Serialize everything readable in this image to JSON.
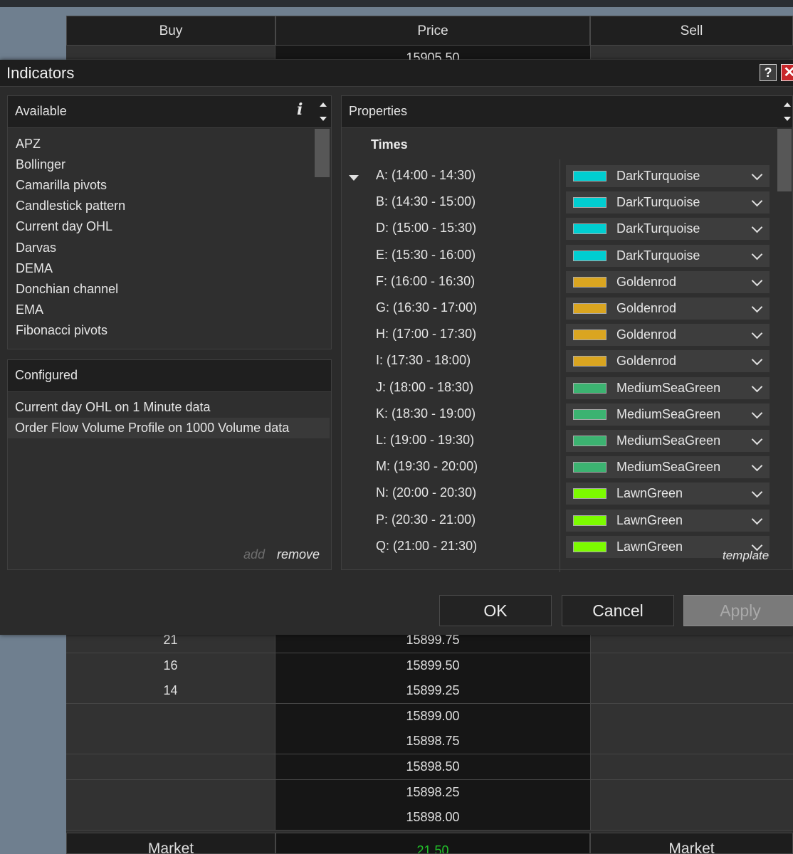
{
  "ladder": {
    "headers": {
      "buy": "Buy",
      "price": "Price",
      "sell": "Sell"
    },
    "top_row": {
      "buy": "",
      "price": "15905.50",
      "sell": ""
    },
    "rows": [
      {
        "buy": "21",
        "price": "15899.75",
        "sell": ""
      },
      {
        "buy": "16",
        "price": "15899.50",
        "sell": ""
      },
      {
        "buy": "14",
        "price": "15899.25",
        "sell": ""
      },
      {
        "buy": "",
        "price": "15899.00",
        "sell": ""
      },
      {
        "buy": "",
        "price": "15898.75",
        "sell": ""
      },
      {
        "buy": "",
        "price": "15898.50",
        "sell": ""
      },
      {
        "buy": "",
        "price": "15898.25",
        "sell": ""
      },
      {
        "buy": "",
        "price": "15898.00",
        "sell": ""
      }
    ],
    "footer": {
      "buy": "Market",
      "price": "21.50",
      "sell": "Market"
    }
  },
  "dialog": {
    "title": "Indicators",
    "help": "?",
    "close": "✕",
    "available": {
      "title": "Available",
      "items": [
        "APZ",
        "Bollinger",
        "Camarilla pivots",
        "Candlestick pattern",
        "Current day OHL",
        "Darvas",
        "DEMA",
        "Donchian channel",
        "EMA",
        "Fibonacci pivots"
      ]
    },
    "configured": {
      "title": "Configured",
      "items": [
        "Current day OHL on 1 Minute data",
        "Order Flow Volume Profile on 1000 Volume data"
      ],
      "selected_index": 1,
      "add_label": "add",
      "remove_label": "remove"
    },
    "properties": {
      "title": "Properties",
      "group": "Times",
      "rows": [
        {
          "label": "A: (14:00 - 14:30)",
          "color_name": "DarkTurquoise",
          "color": "#00ced1"
        },
        {
          "label": "B: (14:30 - 15:00)",
          "color_name": "DarkTurquoise",
          "color": "#00ced1"
        },
        {
          "label": "D: (15:00 - 15:30)",
          "color_name": "DarkTurquoise",
          "color": "#00ced1"
        },
        {
          "label": "E: (15:30 - 16:00)",
          "color_name": "DarkTurquoise",
          "color": "#00ced1"
        },
        {
          "label": "F: (16:00 - 16:30)",
          "color_name": "Goldenrod",
          "color": "#daa520"
        },
        {
          "label": "G: (16:30 - 17:00)",
          "color_name": "Goldenrod",
          "color": "#daa520"
        },
        {
          "label": "H: (17:00 - 17:30)",
          "color_name": "Goldenrod",
          "color": "#daa520"
        },
        {
          "label": "I: (17:30 - 18:00)",
          "color_name": "Goldenrod",
          "color": "#daa520"
        },
        {
          "label": "J: (18:00 - 18:30)",
          "color_name": "MediumSeaGreen",
          "color": "#3cb371"
        },
        {
          "label": "K: (18:30 - 19:00)",
          "color_name": "MediumSeaGreen",
          "color": "#3cb371"
        },
        {
          "label": "L: (19:00 - 19:30)",
          "color_name": "MediumSeaGreen",
          "color": "#3cb371"
        },
        {
          "label": "M: (19:30 - 20:00)",
          "color_name": "MediumSeaGreen",
          "color": "#3cb371"
        },
        {
          "label": "N: (20:00 - 20:30)",
          "color_name": "LawnGreen",
          "color": "#7cfc00"
        },
        {
          "label": "P: (20:30 - 21:00)",
          "color_name": "LawnGreen",
          "color": "#7cfc00"
        },
        {
          "label": "Q: (21:00 - 21:30)",
          "color_name": "LawnGreen",
          "color": "#7cfc00"
        }
      ],
      "template_label": "template"
    },
    "buttons": {
      "ok": "OK",
      "cancel": "Cancel",
      "apply": "Apply"
    }
  }
}
